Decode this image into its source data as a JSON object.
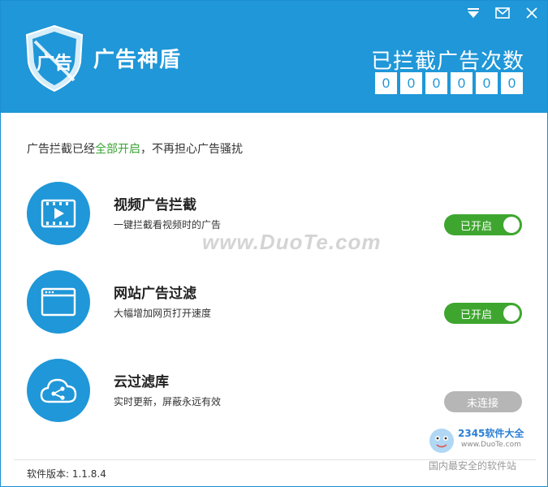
{
  "app": {
    "title": "广告神盾",
    "logo_text": "广告"
  },
  "colors": {
    "header_bg": "#1f97d8",
    "accent_green": "#3ea62f",
    "disabled_gray": "#b6b6b6"
  },
  "window_controls": {
    "menu_icon": "menu-triangle-icon",
    "mail_icon": "envelope-icon",
    "close_icon": "close-icon"
  },
  "counter": {
    "label": "已拦截广告次数",
    "digits": [
      "0",
      "0",
      "0",
      "0",
      "0",
      "0"
    ]
  },
  "status": {
    "prefix": "广告拦截已经",
    "highlight": "全部开启",
    "suffix": "，不再担心广告骚扰"
  },
  "features": [
    {
      "icon": "video-icon",
      "title": "视频广告拦截",
      "desc": "一键拦截看视频时的广告",
      "toggle_label": "已开启",
      "state": "on"
    },
    {
      "icon": "browser-window-icon",
      "title": "网站广告过滤",
      "desc": "大幅增加网页打开速度",
      "toggle_label": "已开启",
      "state": "on"
    },
    {
      "icon": "cloud-share-icon",
      "title": "云过滤库",
      "desc": "实时更新，屏蔽永远有效",
      "toggle_label": "未连接",
      "state": "off"
    }
  ],
  "watermark": "www.DuoTe.com",
  "footer": {
    "version": "软件版本: 1.1.8.4"
  },
  "brand": {
    "logo": "2345软件大全",
    "url": "www.DuoTe.com",
    "tagline": "国内最安全的软件站"
  }
}
